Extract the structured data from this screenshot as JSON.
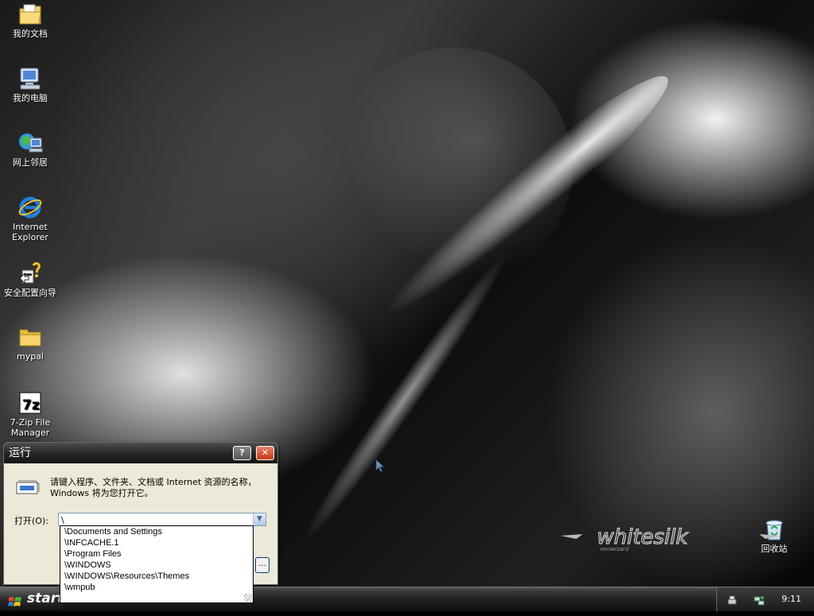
{
  "desktop": {
    "icons": [
      {
        "name": "my-documents-icon",
        "label": "我的文档"
      },
      {
        "name": "my-computer-icon",
        "label": "我的电脑"
      },
      {
        "name": "network-places-icon",
        "label": "网上邻居"
      },
      {
        "name": "internet-explorer-icon",
        "label": "Internet Explorer"
      },
      {
        "name": "security-wizard-icon",
        "label": "安全配置向导"
      },
      {
        "name": "folder-icon",
        "label": "mypal"
      },
      {
        "name": "7zip-icon",
        "label": "7-Zip File Manager"
      },
      {
        "name": "recycle-bin-icon",
        "label": "回收站"
      }
    ],
    "wallpaper_logo": {
      "word": "whitesilk",
      "sub": "neowizard"
    }
  },
  "run_dialog": {
    "title": "运行",
    "help_glyph": "?",
    "close_glyph": "✕",
    "description": "请键入程序、文件夹、文档或 Internet 资源的名称，Windows 将为您打开它。",
    "open_label": "打开(O):",
    "input_value": "\\",
    "autocomplete": [
      "\\Documents and Settings",
      "\\INFCACHE.1",
      "\\Program Files",
      "\\WINDOWS",
      "\\WINDOWS\\Resources\\Themes",
      "\\wmpub"
    ]
  },
  "taskbar": {
    "start_label": "start",
    "clock": "9:11"
  }
}
